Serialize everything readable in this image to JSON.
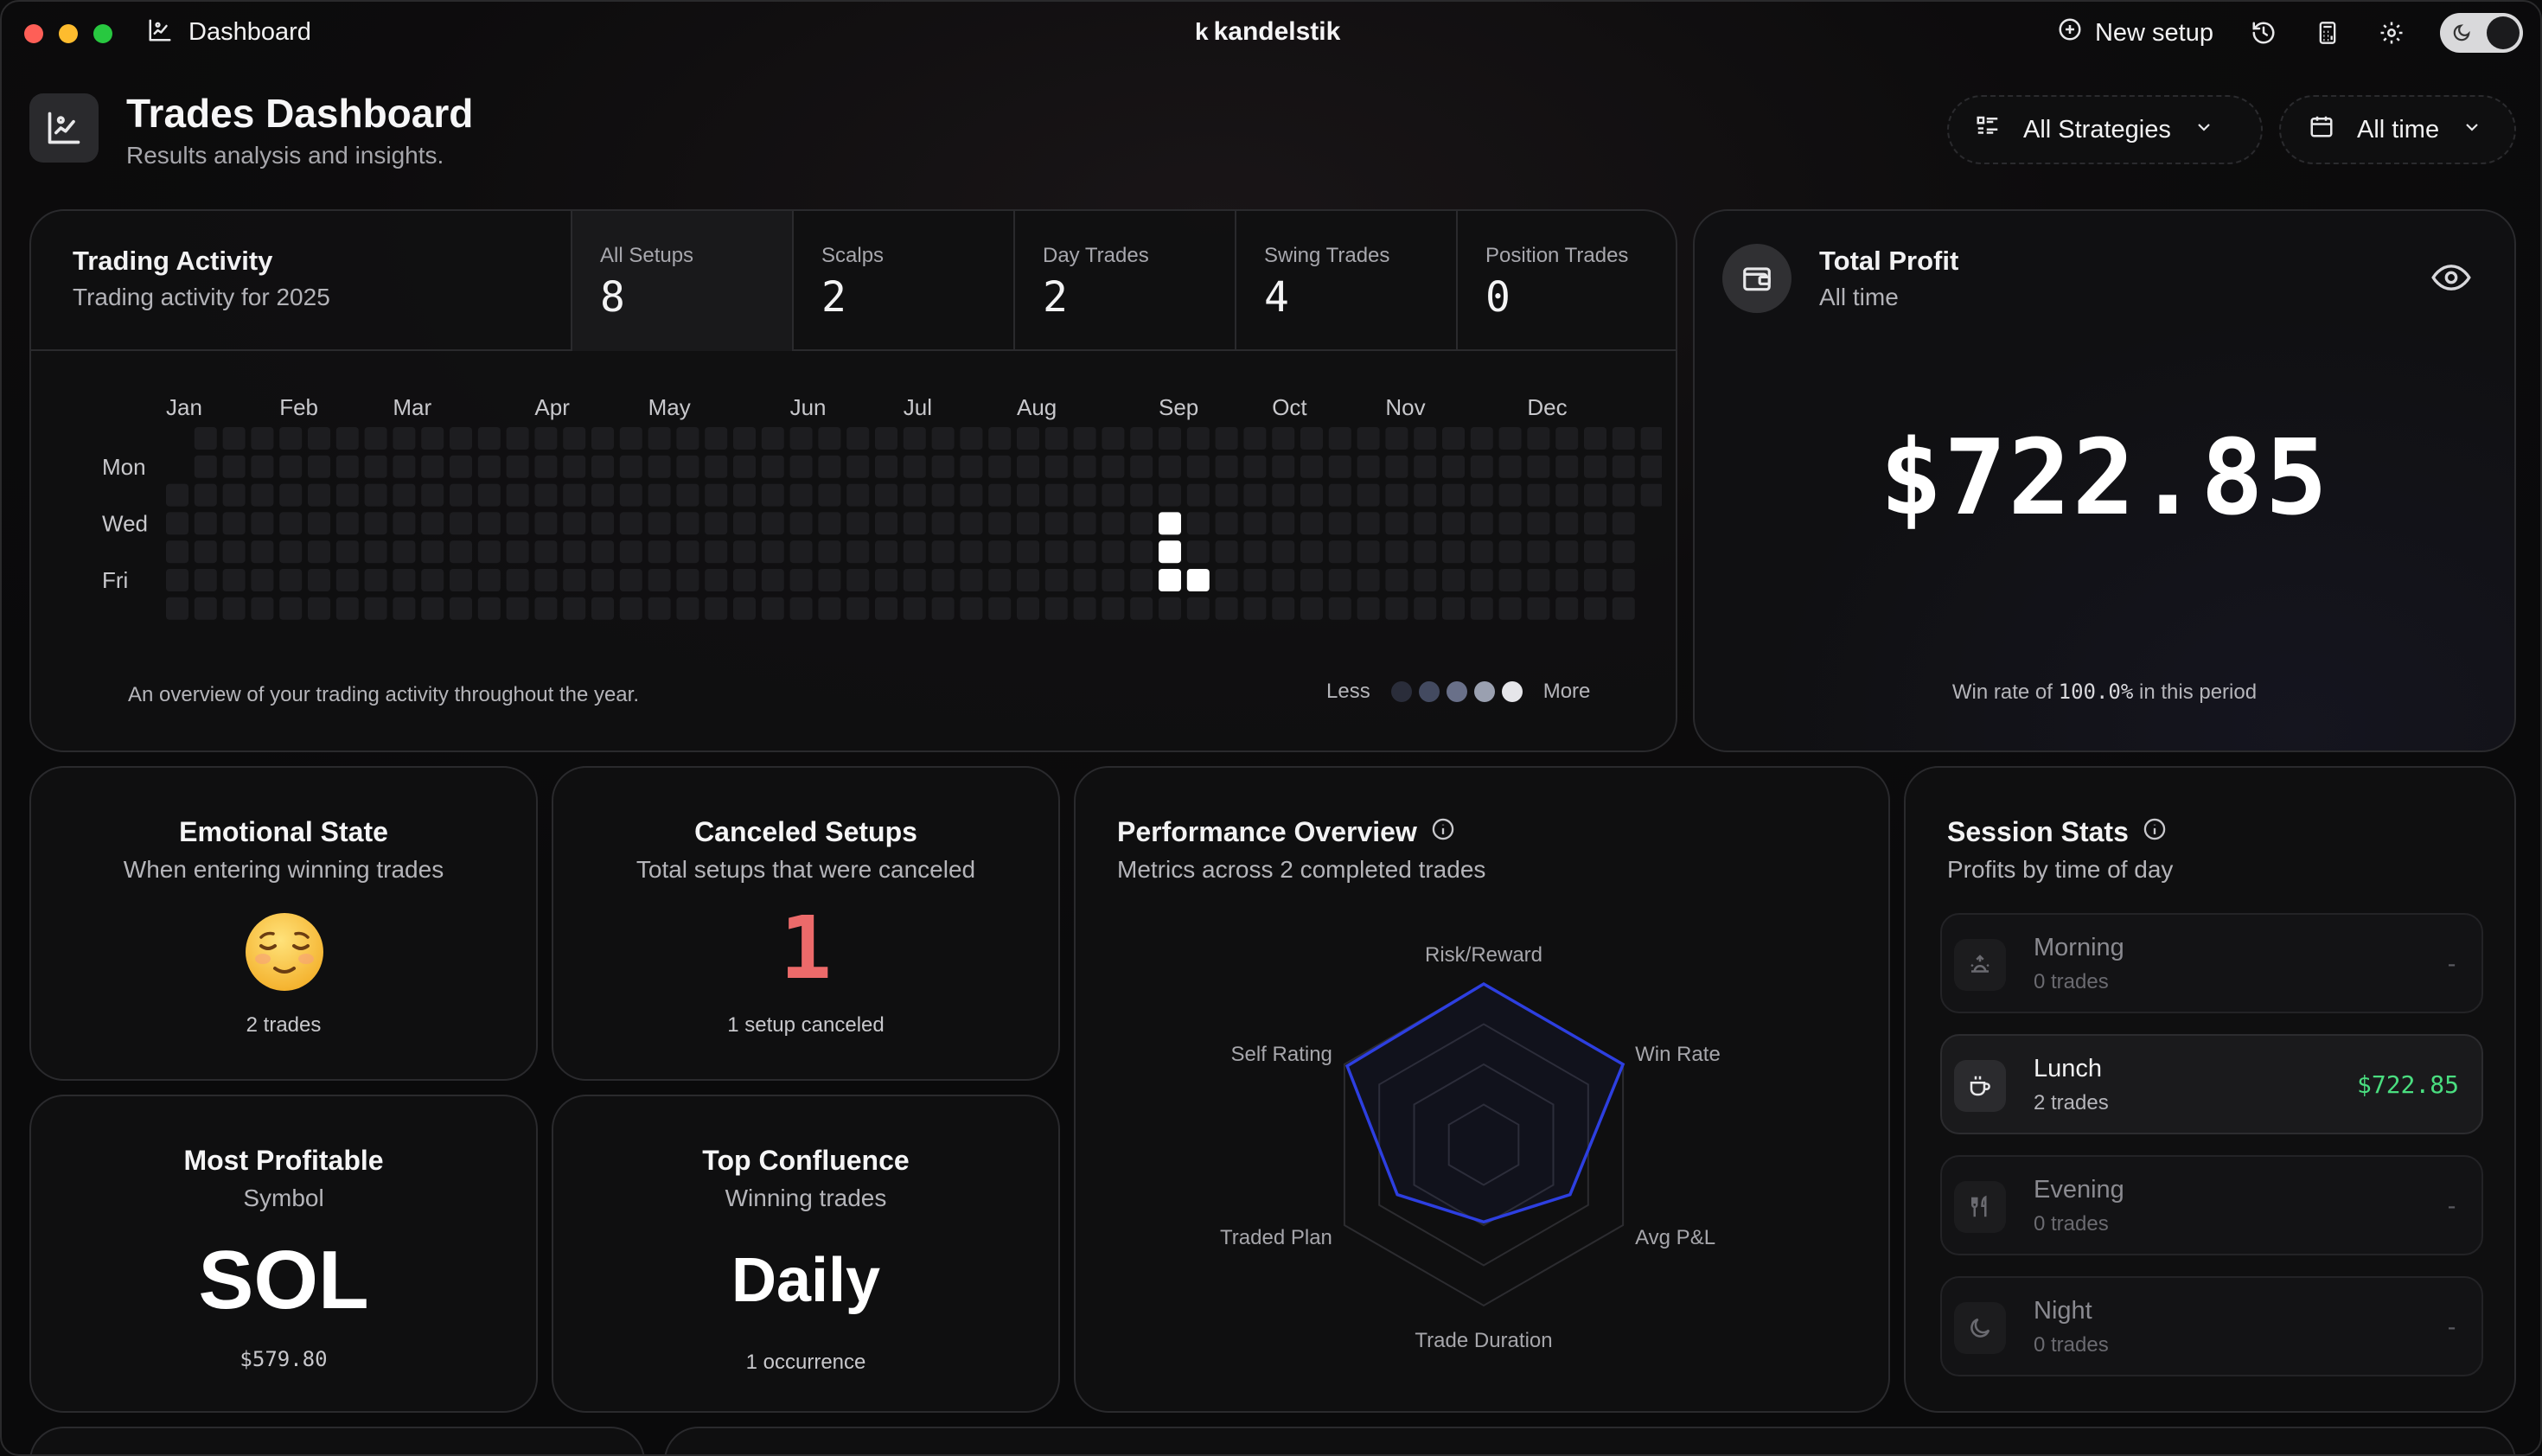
{
  "titlebar": {
    "section_label": "Dashboard",
    "brand": "kandelstik",
    "brand_mark": "k",
    "new_setup_label": "New setup"
  },
  "header": {
    "title": "Trades Dashboard",
    "subtitle": "Results analysis and insights.",
    "strategy_filter": "All Strategies",
    "time_filter": "All time"
  },
  "activity": {
    "title": "Trading Activity",
    "subtitle": "Trading activity for 2025",
    "tabs": [
      {
        "label": "All Setups",
        "value": "8"
      },
      {
        "label": "Scalps",
        "value": "2"
      },
      {
        "label": "Day Trades",
        "value": "2"
      },
      {
        "label": "Swing Trades",
        "value": "4"
      },
      {
        "label": "Position Trades",
        "value": "0"
      }
    ],
    "months": [
      "Jan",
      "Feb",
      "Mar",
      "Apr",
      "May",
      "Jun",
      "Jul",
      "Aug",
      "Sep",
      "Oct",
      "Nov",
      "Dec"
    ],
    "day_labels": [
      "Mon",
      "Wed",
      "Fri"
    ],
    "footer": "An overview of your trading activity throughout the year.",
    "legend_less": "Less",
    "legend_more": "More",
    "legend_colors": [
      "#2a2d3a",
      "#434a60",
      "#697089",
      "#9aa0b0",
      "#e6e6ea"
    ],
    "active_cells": [
      {
        "week": 35,
        "day": 3,
        "level": 5
      },
      {
        "week": 35,
        "day": 4,
        "level": 5
      },
      {
        "week": 35,
        "day": 5,
        "level": 5
      },
      {
        "week": 36,
        "day": 5,
        "level": 5
      }
    ]
  },
  "profit": {
    "title": "Total Profit",
    "subtitle": "All time",
    "value": "$722.85",
    "footer_prefix": "Win rate of",
    "win_rate": "100.0%",
    "footer_suffix": "in this period"
  },
  "emotional": {
    "title": "Emotional State",
    "subtitle": "When entering winning trades",
    "emoji": "relieved-face",
    "footer": "2 trades"
  },
  "canceled": {
    "title": "Canceled Setups",
    "subtitle": "Total setups that were canceled",
    "value": "1",
    "footer": "1 setup canceled",
    "color": "#ec6a6a"
  },
  "symbol": {
    "title": "Most Profitable",
    "subtitle": "Symbol",
    "value": "SOL",
    "footer": "$579.80"
  },
  "confluence": {
    "title": "Top Confluence",
    "subtitle": "Winning trades",
    "value": "Daily",
    "footer": "1 occurrence"
  },
  "performance": {
    "title": "Performance Overview",
    "subtitle": "Metrics across 2 completed trades",
    "axes": [
      "Risk/Reward",
      "Win Rate",
      "Avg P&L",
      "Trade Duration",
      "Traded Plan",
      "Self Rating"
    ],
    "scores": [
      1.0,
      1.0,
      0.62,
      0.48,
      0.62,
      0.98
    ],
    "line_color": "#2d3fe0"
  },
  "sessions": {
    "title": "Session Stats",
    "subtitle": "Profits by time of day",
    "rows": [
      {
        "name": "Morning",
        "count": "0 trades",
        "value": "-",
        "icon": "sunrise-icon"
      },
      {
        "name": "Lunch",
        "count": "2 trades",
        "value": "$722.85",
        "icon": "coffee-icon"
      },
      {
        "name": "Evening",
        "count": "0 trades",
        "value": "-",
        "icon": "utensils-icon"
      },
      {
        "name": "Night",
        "count": "0 trades",
        "value": "-",
        "icon": "moon-icon"
      }
    ],
    "positive_color": "#4ade80"
  }
}
